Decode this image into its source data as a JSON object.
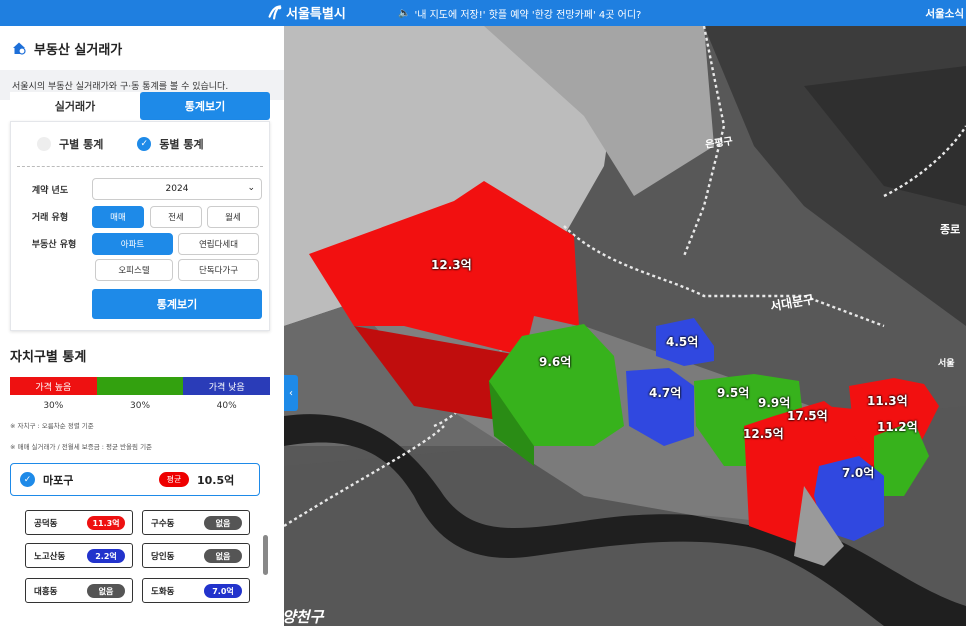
{
  "topbar": {
    "site_name": "서울특별시",
    "notice": "'내 지도에 저장!' 핫플 예약 '한강 전망카페' 4곳 어디?",
    "news_link": "서울소식"
  },
  "panel": {
    "title": "부동산 실거래가",
    "description": "서울시의 부동산 실거래가와 구·동 통계를 볼 수 있습니다.",
    "tabs": [
      {
        "label": "실거래가",
        "active": false
      },
      {
        "label": "통계보기",
        "active": true
      }
    ],
    "radio_district": "구별 통계",
    "radio_dong": "동별 통계",
    "year_label": "계약 년도",
    "year_value": "2024",
    "deal_type_label": "거래 유형",
    "deal_types": [
      "매매",
      "전세",
      "월세"
    ],
    "property_type_label": "부동산 유형",
    "property_types": [
      "아파트",
      "연립다세대",
      "오피스텔",
      "단독다가구"
    ],
    "submit_label": "통계보기"
  },
  "stats": {
    "title": "자치구별 통계",
    "legend": {
      "high": "가격 높음",
      "mid": "",
      "low": "가격 낮음"
    },
    "legend_colors": {
      "high": "#ee1111",
      "mid": "#33a10f",
      "low": "#2a3cb8"
    },
    "legend_pct": [
      "30%",
      "30%",
      "40%"
    ],
    "note1": "※ 자치구 : 오름차순 정렬 기준",
    "note2": "※ 매매 실거래가 / 전월세 보증금 : 평균 반올림 기준",
    "district": {
      "name": "마포구",
      "avg_label": "평균",
      "avg_value": "10.5억"
    },
    "dongs": [
      {
        "name": "공덕동",
        "value": "11.3억",
        "level": "red"
      },
      {
        "name": "구수동",
        "value": "없음",
        "level": "gray"
      },
      {
        "name": "노고산동",
        "value": "2.2억",
        "level": "blue"
      },
      {
        "name": "당인동",
        "value": "없음",
        "level": "gray"
      },
      {
        "name": "대흥동",
        "value": "없음",
        "level": "gray"
      },
      {
        "name": "도화동",
        "value": "7.0억",
        "level": "blue"
      }
    ]
  },
  "map": {
    "place_labels": [
      "은평구",
      "서대문구",
      "종로",
      "양천구",
      "서울"
    ],
    "price_labels": [
      {
        "text": "12.3억",
        "level": "red"
      },
      {
        "text": "9.6억",
        "level": "green"
      },
      {
        "text": "4.5억",
        "level": "blue"
      },
      {
        "text": "4.7억",
        "level": "blue"
      },
      {
        "text": "9.5억",
        "level": "green"
      },
      {
        "text": "9.9억",
        "level": "green"
      },
      {
        "text": "17.5억",
        "level": "red"
      },
      {
        "text": "12.5억",
        "level": "red"
      },
      {
        "text": "11.3억",
        "level": "red"
      },
      {
        "text": "11.2억",
        "level": "green"
      },
      {
        "text": "7.0억",
        "level": "blue"
      }
    ]
  }
}
